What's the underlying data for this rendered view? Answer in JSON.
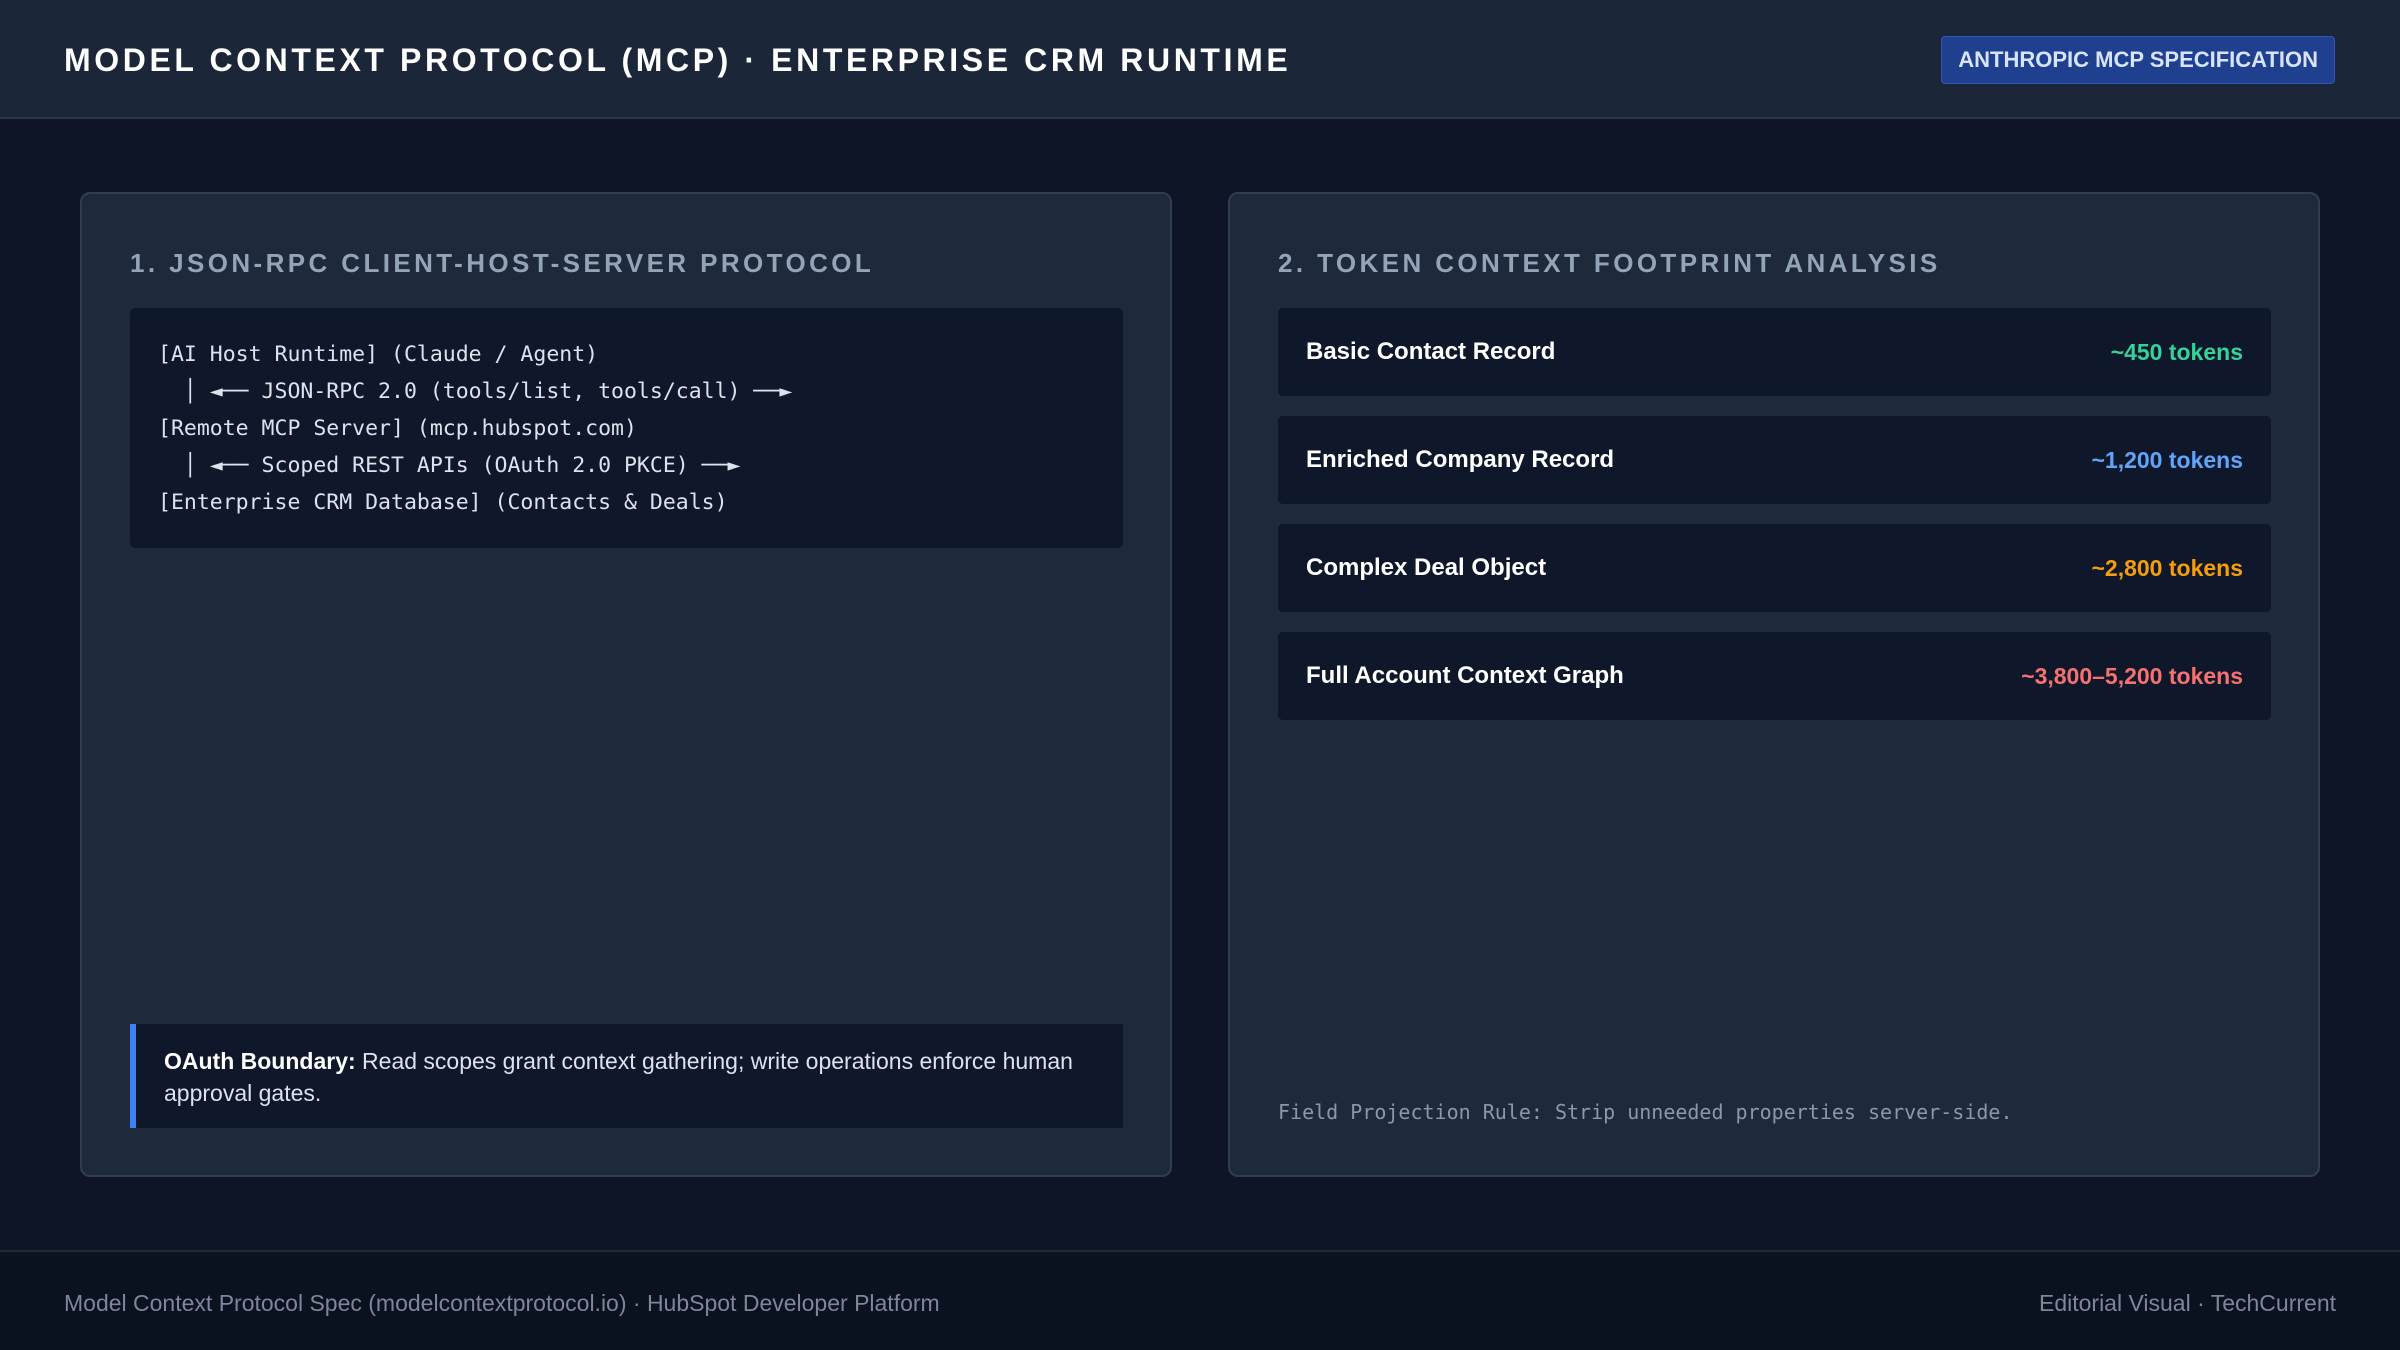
{
  "header": {
    "title": "MODEL CONTEXT PROTOCOL (MCP) · ENTERPRISE CRM RUNTIME",
    "badge": "ANTHROPIC MCP SPECIFICATION"
  },
  "left_panel": {
    "title": "1. JSON-RPC CLIENT-HOST-SERVER PROTOCOL",
    "diagram_lines": [
      "[AI Host Runtime] (Claude / Agent)",
      "  │ ◄── JSON-RPC 2.0 (tools/list, tools/call) ──►",
      "[Remote MCP Server] (mcp.hubspot.com)",
      "  │ ◄── Scoped REST APIs (OAuth 2.0 PKCE) ──►",
      "[Enterprise CRM Database] (Contacts & Deals)"
    ],
    "callout": {
      "label": "OAuth Boundary:",
      "text": " Read scopes grant context gathering; write operations enforce human approval gates."
    }
  },
  "right_panel": {
    "title": "2. TOKEN CONTEXT FOOTPRINT ANALYSIS",
    "rows": [
      {
        "label": "Basic Contact Record",
        "value": "~450 tokens",
        "color": "#34d399"
      },
      {
        "label": "Enriched Company Record",
        "value": "~1,200 tokens",
        "color": "#60a5fa"
      },
      {
        "label": "Complex Deal Object",
        "value": "~2,800 tokens",
        "color": "#f59e0b"
      },
      {
        "label": "Full Account Context Graph",
        "value": "~3,800–5,200 tokens",
        "color": "#f87171"
      }
    ],
    "footnote": "Field Projection Rule: Strip unneeded properties server-side."
  },
  "footer": {
    "left": "Model Context Protocol Spec (modelcontextprotocol.io) · HubSpot Developer Platform",
    "right": "Editorial Visual · TechCurrent"
  },
  "colors": {
    "background": "#0d1526",
    "panel": "#1e293b",
    "accent": "#3b82f6"
  }
}
